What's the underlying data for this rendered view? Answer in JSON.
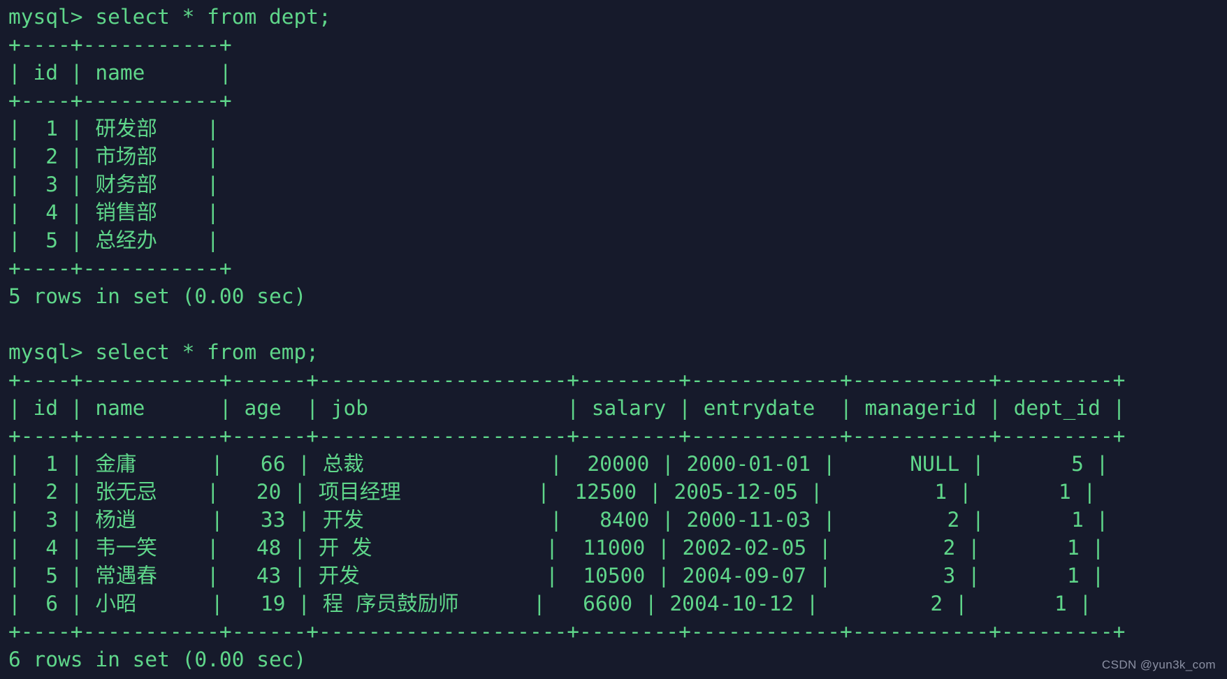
{
  "terminal": {
    "prompt": "mysql>",
    "colors": {
      "background": "#161a2b",
      "text": "#5fd68a",
      "watermark": "#8b90a3"
    },
    "watermark": "CSDN @yun3k_com"
  },
  "blocks": [
    {
      "command": "mysql> select * from dept;",
      "border": "+----+-----------+",
      "header": "| id | name      |",
      "rows": [
        "|  1 | 研发部    |",
        "|  2 | 市场部    |",
        "|  3 | 财务部    |",
        "|  4 | 销售部    |",
        "|  5 | 总经办    |"
      ],
      "footer": "5 rows in set (0.00 sec)",
      "table": {
        "name": "dept",
        "columns": [
          "id",
          "name"
        ],
        "data": [
          [
            "1",
            "研发部"
          ],
          [
            "2",
            "市场部"
          ],
          [
            "3",
            "财务部"
          ],
          [
            "4",
            "销售部"
          ],
          [
            "5",
            "总经办"
          ]
        ],
        "row_count": 5,
        "elapsed": "0.00 sec"
      }
    },
    {
      "command": "mysql> select * from emp;",
      "border": "+----+-----------+------+--------------------+--------+------------+-----------+---------+",
      "header": "| id | name      | age  | job                | salary | entrydate  | managerid | dept_id |",
      "rows": [
        "|  1 | 金庸      |   66 | 总裁               |  20000 | 2000-01-01 |      NULL |       5 |",
        "|  2 | 张无忌    |   20 | 项目经理           |  12500 | 2005-12-05 |         1 |       1 |",
        "|  3 | 杨逍      |   33 | 开发               |   8400 | 2000-11-03 |         2 |       1 |",
        "|  4 | 韦一笑    |   48 | 开 发              |  11000 | 2002-02-05 |         2 |       1 |",
        "|  5 | 常遇春    |   43 | 开发               |  10500 | 2004-09-07 |         3 |       1 |",
        "|  6 | 小昭      |   19 | 程 序员鼓励师      |   6600 | 2004-10-12 |         2 |       1 |"
      ],
      "footer": "6 rows in set (0.00 sec)",
      "table": {
        "name": "emp",
        "columns": [
          "id",
          "name",
          "age",
          "job",
          "salary",
          "entrydate",
          "managerid",
          "dept_id"
        ],
        "data": [
          [
            "1",
            "金庸",
            "66",
            "总裁",
            "20000",
            "2000-01-01",
            "NULL",
            "5"
          ],
          [
            "2",
            "张无忌",
            "20",
            "项目经理",
            "12500",
            "2005-12-05",
            "1",
            "1"
          ],
          [
            "3",
            "杨逍",
            "33",
            "开发",
            "8400",
            "2000-11-03",
            "2",
            "1"
          ],
          [
            "4",
            "韦一笑",
            "48",
            "开 发",
            "11000",
            "2002-02-05",
            "2",
            "1"
          ],
          [
            "5",
            "常遇春",
            "43",
            "开发",
            "10500",
            "2004-09-07",
            "3",
            "1"
          ],
          [
            "6",
            "小昭",
            "19",
            "程 序员鼓励师",
            "6600",
            "2004-10-12",
            "2",
            "1"
          ]
        ],
        "row_count": 6,
        "elapsed": "0.00 sec"
      }
    }
  ]
}
